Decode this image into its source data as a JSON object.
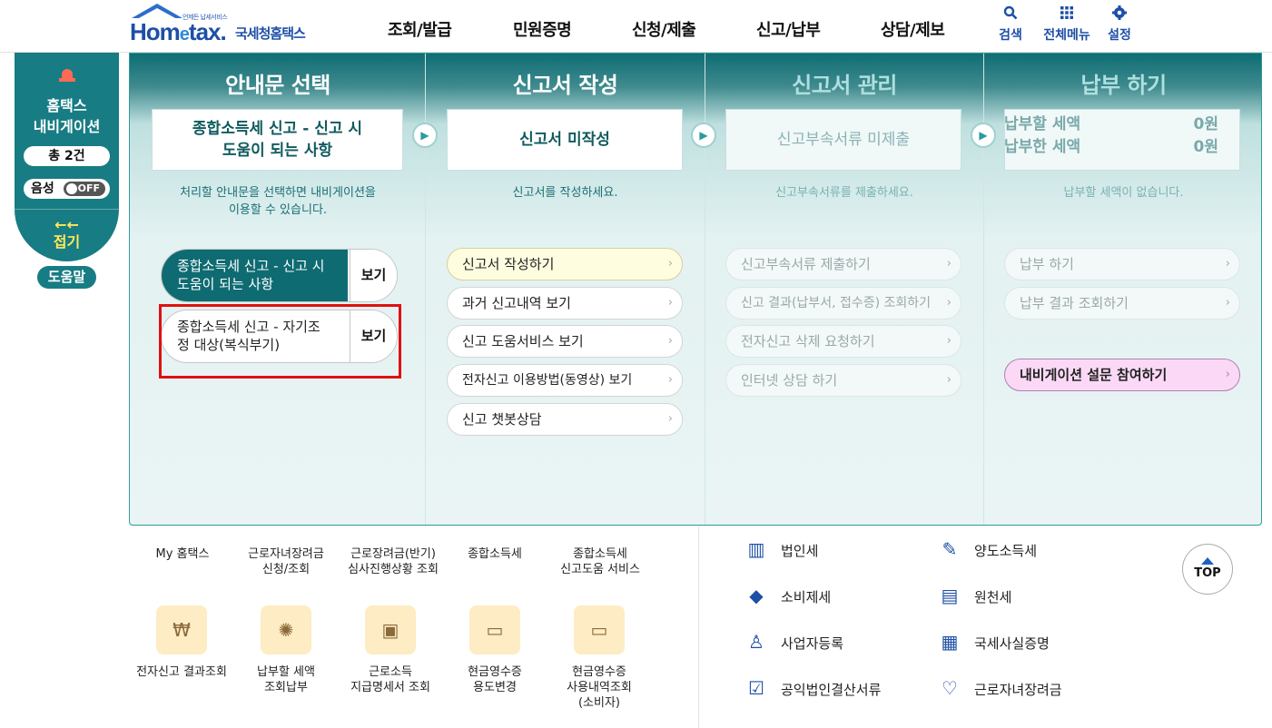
{
  "header": {
    "logo_sub": "언제든 납세서비스",
    "logo_home": "Hom",
    "logo_e": "e",
    "logo_tax": "tax.",
    "logo_kr": "국세청홈택스",
    "menu": [
      "조회/발급",
      "민원증명",
      "신청/제출",
      "신고/납부",
      "상담/제보"
    ],
    "util": [
      {
        "label": "검색",
        "icon": "search-icon"
      },
      {
        "label": "전체메뉴",
        "icon": "grid-icon"
      },
      {
        "label": "설정",
        "icon": "gear-icon"
      }
    ]
  },
  "left_nav": {
    "title_1": "홈택스",
    "title_2": "내비게이션",
    "count": "총 2건",
    "voice_label": "음성",
    "voice_toggle": "OFF",
    "collapse_arrows": "←←",
    "collapse": "접기",
    "help": "도움말"
  },
  "panel": {
    "steps": [
      {
        "title": "안내문 선택",
        "box_line1": "종합소득세 신고 - 신고 시",
        "box_line2": "도움이 되는 사항",
        "hint_line1": "처리할 안내문을 선택하면 내비게이션을",
        "hint_line2": "이용할 수 있습니다."
      },
      {
        "title": "신고서 작성",
        "box_line1": "신고서 미작성",
        "hint_line1": "신고서를 작성하세요."
      },
      {
        "title": "신고서 관리",
        "box_line1": "신고부속서류 미제출",
        "hint_line1": "신고부속서류를 제출하세요."
      },
      {
        "title": "납부 하기",
        "pay_label_1": "납부할 세액",
        "pay_value_1": "0원",
        "pay_label_2": "납부한 세액",
        "pay_value_2": "0원",
        "hint_line1": "납부할 세액이 없습니다."
      }
    ],
    "guides": [
      {
        "line1": "종합소득세 신고 - 신고 시",
        "line2": "도움이 되는 사항",
        "view": "보기"
      },
      {
        "line1": "종합소득세 신고 - 자기조",
        "line2": "정 대상(복식부기)",
        "view": "보기"
      }
    ],
    "col2_actions": [
      "신고서 작성하기",
      "과거 신고내역 보기",
      "신고 도움서비스 보기",
      "전자신고 이용방법(동영상) 보기",
      "신고 챗봇상담"
    ],
    "col3_actions": [
      "신고부속서류 제출하기",
      "신고 결과(납부서, 접수증) 조회하기",
      "전자신고 삭제 요청하기",
      "인터넷 상담 하기"
    ],
    "col4_actions": [
      "납부 하기",
      "납부 결과 조회하기"
    ],
    "survey": "내비게이션 설문 참여하기"
  },
  "bottom": {
    "row1": [
      {
        "line1": "My 홈택스",
        "line2": ""
      },
      {
        "line1": "근로자녀장려금",
        "line2": "신청/조회"
      },
      {
        "line1": "근로장려금(반기)",
        "line2": "심사진행상황 조회"
      },
      {
        "line1": "종합소득세",
        "line2": ""
      },
      {
        "line1": "종합소득세",
        "line2": "신고도움 서비스"
      }
    ],
    "row2": [
      {
        "line1": "전자신고 결과조회",
        "line2": "",
        "line3": "",
        "icon": "won-search-icon"
      },
      {
        "line1": "납부할 세액",
        "line2": "조회납부",
        "line3": "",
        "icon": "money-bag-icon"
      },
      {
        "line1": "근로소득",
        "line2": "지급명세서 조회",
        "line3": "",
        "icon": "wallet-icon"
      },
      {
        "line1": "현금영수증",
        "line2": "용도변경",
        "line3": "",
        "icon": "receipt-icon"
      },
      {
        "line1": "현금영수증",
        "line2": "사용내역조회",
        "line3": "(소비자)",
        "icon": "receipt-search-icon"
      }
    ],
    "taxes_left": [
      {
        "label": "법인세",
        "icon": "building-icon"
      },
      {
        "label": "소비제세",
        "icon": "diamond-icon"
      },
      {
        "label": "사업자등록",
        "icon": "person-icon"
      },
      {
        "label": "공익법인결산서류",
        "icon": "clipboard-icon"
      }
    ],
    "taxes_right": [
      {
        "label": "양도소득세",
        "icon": "document-pen-icon"
      },
      {
        "label": "원천세",
        "icon": "sal-document-icon"
      },
      {
        "label": "국세사실증명",
        "icon": "certificate-icon"
      },
      {
        "label": "근로자녀장려금",
        "icon": "heart-hand-icon"
      }
    ],
    "top_button": "TOP"
  }
}
